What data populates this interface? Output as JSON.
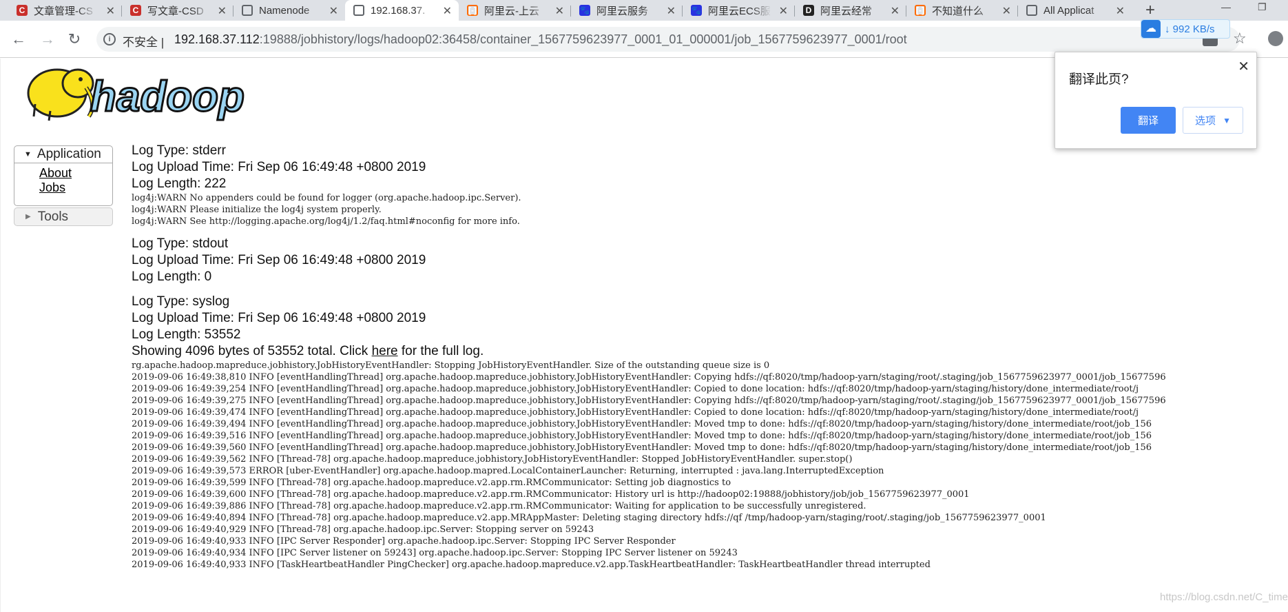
{
  "tabs": [
    {
      "title": "文章管理-CS",
      "icon": "csdn-icon",
      "active": false
    },
    {
      "title": "写文章-CSD",
      "icon": "csdn-icon",
      "active": false
    },
    {
      "title": "Namenode",
      "icon": "globe-icon",
      "active": false
    },
    {
      "title": "192.168.37.",
      "icon": "globe-icon",
      "active": true
    },
    {
      "title": "阿里云-上云",
      "icon": "aliyun-icon",
      "active": false
    },
    {
      "title": "阿里云服务",
      "icon": "baidu-icon",
      "active": false
    },
    {
      "title": "阿里云ECS服",
      "icon": "baidu-icon",
      "active": false
    },
    {
      "title": "阿里云经常",
      "icon": "bookmark-icon",
      "active": false
    },
    {
      "title": "不知道什么",
      "icon": "aliyun-icon",
      "active": false
    },
    {
      "title": "All Applicat",
      "icon": "globe-icon",
      "active": false
    }
  ],
  "toolbar": {
    "security": "不安全",
    "url_host": "192.168.37.112",
    "url_rest": ":19888/jobhistory/logs/hadoop02:36458/container_1567759623977_0001_01_000001/job_1567759623977_0001/root",
    "speed": "992 KB/s"
  },
  "translate_popup": {
    "title": "翻译此页?",
    "translate": "翻译",
    "options": "选项"
  },
  "sidebar": {
    "application": "Application",
    "about": "About",
    "jobs": "Jobs",
    "tools": "Tools"
  },
  "logs": {
    "stderr": {
      "type": "Log Type: stderr",
      "upload": "Log Upload Time: Fri Sep 06 16:49:48 +0800 2019",
      "length": "Log Length: 222",
      "body": "log4j:WARN No appenders could be found for logger (org.apache.hadoop.ipc.Server).\nlog4j:WARN Please initialize the log4j system properly.\nlog4j:WARN See http://logging.apache.org/log4j/1.2/faq.html#noconfig for more info."
    },
    "stdout": {
      "type": "Log Type: stdout",
      "upload": "Log Upload Time: Fri Sep 06 16:49:48 +0800 2019",
      "length": "Log Length: 0"
    },
    "syslog": {
      "type": "Log Type: syslog",
      "upload": "Log Upload Time: Fri Sep 06 16:49:48 +0800 2019",
      "length": "Log Length: 53552",
      "showing_prefix": "Showing 4096 bytes of 53552 total. Click ",
      "here": "here",
      "showing_suffix": " for the full log.",
      "body": "rg.apache.hadoop.mapreduce.jobhistory.JobHistoryEventHandler: Stopping JobHistoryEventHandler. Size of the outstanding queue size is 0\n2019-09-06 16:49:38,810 INFO [eventHandlingThread] org.apache.hadoop.mapreduce.jobhistory.JobHistoryEventHandler: Copying hdfs://qf:8020/tmp/hadoop-yarn/staging/root/.staging/job_1567759623977_0001/job_15677596\n2019-09-06 16:49:39,254 INFO [eventHandlingThread] org.apache.hadoop.mapreduce.jobhistory.JobHistoryEventHandler: Copied to done location: hdfs://qf:8020/tmp/hadoop-yarn/staging/history/done_intermediate/root/j\n2019-09-06 16:49:39,275 INFO [eventHandlingThread] org.apache.hadoop.mapreduce.jobhistory.JobHistoryEventHandler: Copying hdfs://qf:8020/tmp/hadoop-yarn/staging/root/.staging/job_1567759623977_0001/job_15677596\n2019-09-06 16:49:39,474 INFO [eventHandlingThread] org.apache.hadoop.mapreduce.jobhistory.JobHistoryEventHandler: Copied to done location: hdfs://qf:8020/tmp/hadoop-yarn/staging/history/done_intermediate/root/j\n2019-09-06 16:49:39,494 INFO [eventHandlingThread] org.apache.hadoop.mapreduce.jobhistory.JobHistoryEventHandler: Moved tmp to done: hdfs://qf:8020/tmp/hadoop-yarn/staging/history/done_intermediate/root/job_156\n2019-09-06 16:49:39,516 INFO [eventHandlingThread] org.apache.hadoop.mapreduce.jobhistory.JobHistoryEventHandler: Moved tmp to done: hdfs://qf:8020/tmp/hadoop-yarn/staging/history/done_intermediate/root/job_156\n2019-09-06 16:49:39,560 INFO [eventHandlingThread] org.apache.hadoop.mapreduce.jobhistory.JobHistoryEventHandler: Moved tmp to done: hdfs://qf:8020/tmp/hadoop-yarn/staging/history/done_intermediate/root/job_156\n2019-09-06 16:49:39,562 INFO [Thread-78] org.apache.hadoop.mapreduce.jobhistory.JobHistoryEventHandler: Stopped JobHistoryEventHandler. super.stop()\n2019-09-06 16:49:39,573 ERROR [uber-EventHandler] org.apache.hadoop.mapred.LocalContainerLauncher: Returning, interrupted : java.lang.InterruptedException\n2019-09-06 16:49:39,599 INFO [Thread-78] org.apache.hadoop.mapreduce.v2.app.rm.RMCommunicator: Setting job diagnostics to\n2019-09-06 16:49:39,600 INFO [Thread-78] org.apache.hadoop.mapreduce.v2.app.rm.RMCommunicator: History url is http://hadoop02:19888/jobhistory/job/job_1567759623977_0001\n2019-09-06 16:49:39,886 INFO [Thread-78] org.apache.hadoop.mapreduce.v2.app.rm.RMCommunicator: Waiting for application to be successfully unregistered.\n2019-09-06 16:49:40,894 INFO [Thread-78] org.apache.hadoop.mapreduce.v2.app.MRAppMaster: Deleting staging directory hdfs://qf /tmp/hadoop-yarn/staging/root/.staging/job_1567759623977_0001\n2019-09-06 16:49:40,929 INFO [Thread-78] org.apache.hadoop.ipc.Server: Stopping server on 59243\n2019-09-06 16:49:40,933 INFO [IPC Server Responder] org.apache.hadoop.ipc.Server: Stopping IPC Server Responder\n2019-09-06 16:49:40,934 INFO [IPC Server listener on 59243] org.apache.hadoop.ipc.Server: Stopping IPC Server listener on 59243\n2019-09-06 16:49:40,933 INFO [TaskHeartbeatHandler PingChecker] org.apache.hadoop.mapreduce.v2.app.TaskHeartbeatHandler: TaskHeartbeatHandler thread interrupted"
    }
  },
  "logo_text": "hadoop",
  "watermark": "https://blog.csdn.net/C_time"
}
